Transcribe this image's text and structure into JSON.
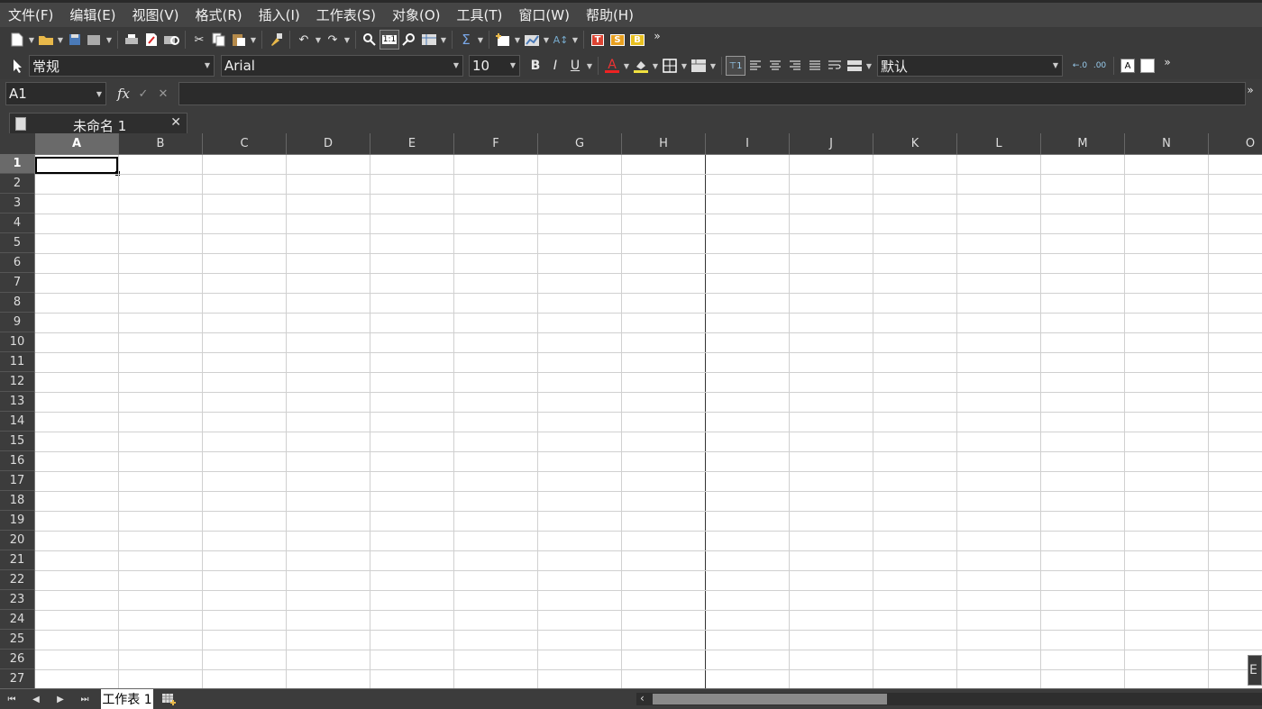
{
  "menu": [
    "文件(F)",
    "编辑(E)",
    "视图(V)",
    "格式(R)",
    "插入(I)",
    "工作表(S)",
    "对象(O)",
    "工具(T)",
    "窗口(W)",
    "帮助(H)"
  ],
  "format_bar": {
    "style_value": "常规",
    "font_value": "Arial",
    "size_value": "10",
    "bold_label": "B",
    "italic_label": "I",
    "underline_label": "U",
    "font_color_label": "A",
    "default_value": "默认"
  },
  "formula_bar": {
    "cell_ref": "A1",
    "fx_label": "fx",
    "formula_value": ""
  },
  "document_tab": {
    "title": "未命名 1"
  },
  "columns": [
    "A",
    "B",
    "C",
    "D",
    "E",
    "F",
    "G",
    "H",
    "I",
    "J",
    "K",
    "L",
    "M",
    "N",
    "O"
  ],
  "rows": [
    "1",
    "2",
    "3",
    "4",
    "5",
    "6",
    "7",
    "8",
    "9",
    "10",
    "11",
    "12",
    "13",
    "14",
    "15",
    "16",
    "17",
    "18",
    "19",
    "20",
    "21",
    "22",
    "23",
    "24",
    "25",
    "26",
    "27"
  ],
  "sheet_tab": {
    "label": "工作表 1"
  },
  "float_panel_letter": "E",
  "colors": {
    "selected_header": "#6a6a6a",
    "background": "#3c3c3c"
  }
}
